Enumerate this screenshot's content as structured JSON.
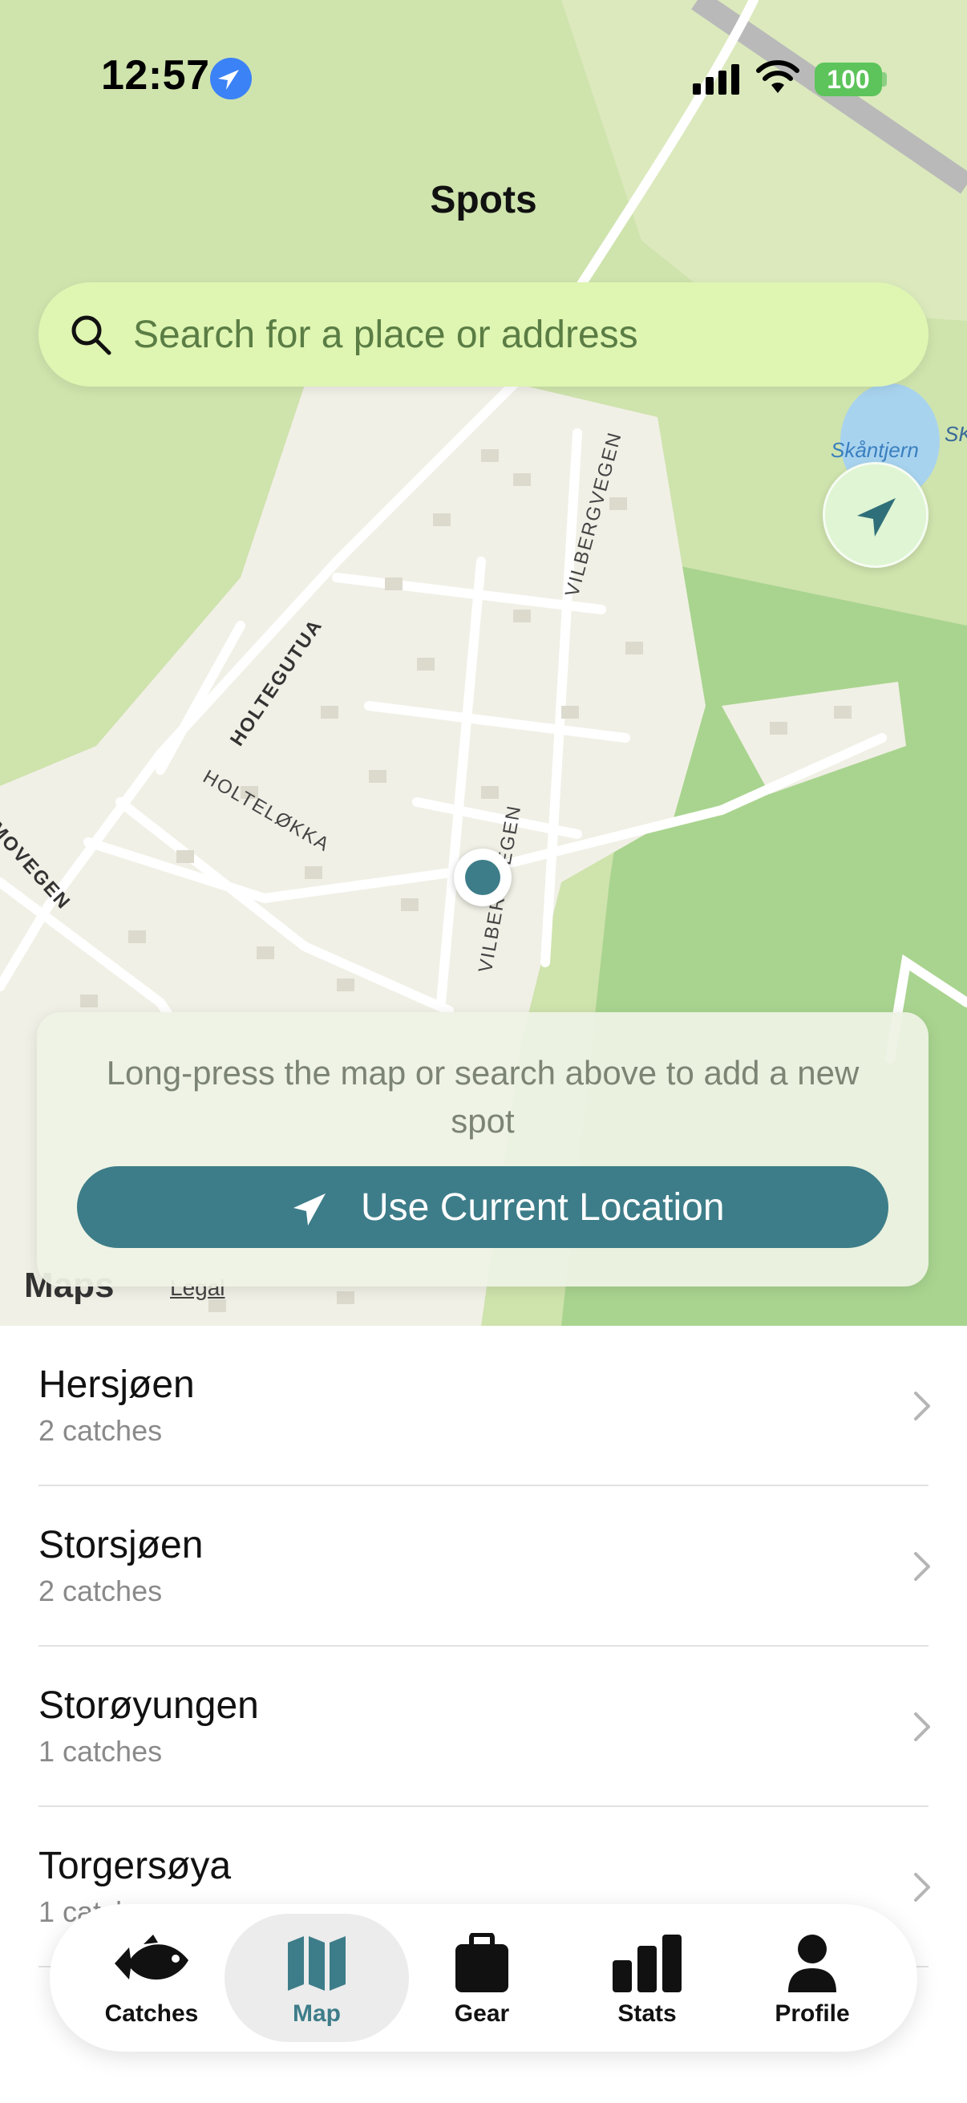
{
  "status_bar": {
    "time": "12:57",
    "battery": "100"
  },
  "header": {
    "title": "Spots"
  },
  "search": {
    "placeholder": "Search for a place or address"
  },
  "map": {
    "street_labels": [
      "HOLTEGUTUA",
      "HOLTELØKKA",
      "VILBERGVEGEN",
      "VILBERGVEGEN",
      "MOVEGEN"
    ],
    "lake_label": "Skåntjern",
    "lake_label_partial": "SK",
    "attribution": {
      "logo": "Maps",
      "legal": "Legal"
    }
  },
  "hint_card": {
    "text": "Long-press the map or search above to add a new spot",
    "button_label": "Use Current Location"
  },
  "spots": [
    {
      "name": "Hersjøen",
      "catches": "2 catches"
    },
    {
      "name": "Storsjøen",
      "catches": "2 catches"
    },
    {
      "name": "Storøyungen",
      "catches": "1 catches"
    },
    {
      "name": "Torgersøya",
      "catches": "1 catches"
    }
  ],
  "tabs": [
    {
      "label": "Catches",
      "icon": "fish-icon"
    },
    {
      "label": "Map",
      "icon": "map-icon",
      "active": true
    },
    {
      "label": "Gear",
      "icon": "briefcase-icon"
    },
    {
      "label": "Stats",
      "icon": "bar-chart-icon"
    },
    {
      "label": "Profile",
      "icon": "person-icon"
    }
  ],
  "colors": {
    "accent": "#3d7d89",
    "search_bg": "#dff5b2",
    "map_green": "#cfe3ad",
    "map_residential": "#f1f0e6"
  }
}
